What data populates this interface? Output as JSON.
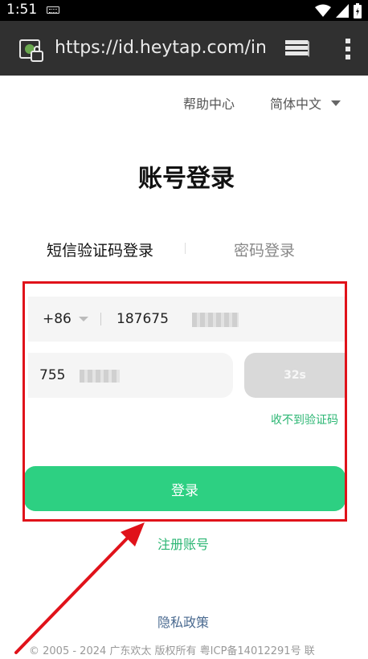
{
  "status_bar": {
    "time": "1:51",
    "icons": [
      "keyboard-icon",
      "wifi-icon",
      "signal-icon",
      "battery-icon"
    ]
  },
  "browser": {
    "url": "https://id.heytap.com/ind",
    "icons": [
      "site-security-icon",
      "tabs-icon",
      "overflow-menu-icon"
    ]
  },
  "header": {
    "help": "帮助中心",
    "language": "简体中文"
  },
  "title": "账号登录",
  "tabs": [
    {
      "label": "短信验证码登录",
      "active": true
    },
    {
      "label": "密码登录",
      "active": false
    }
  ],
  "form": {
    "country_code": "+86",
    "phone_value": "187675",
    "code_value": "755",
    "countdown": "32s",
    "no_code_link": "收不到验证码",
    "login_button": "登录"
  },
  "links": {
    "register": "注册账号",
    "privacy": "隐私政策"
  },
  "footer": "© 2005 - 2024 广东欢太 版权所有 粤ICP备14012291号 联",
  "colors": {
    "accent_green": "#2dd082",
    "link_green": "#2bb673",
    "annotation_red": "#e0121a",
    "url_bar_bg": "#303030"
  }
}
